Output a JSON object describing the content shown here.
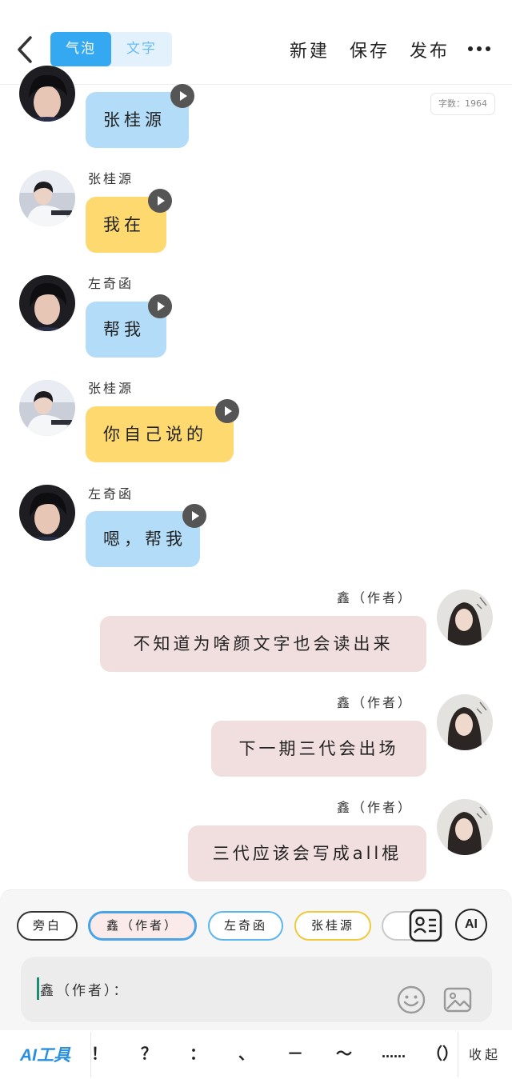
{
  "header": {
    "tabs": [
      {
        "label": "气泡",
        "active": true
      },
      {
        "label": "文字",
        "active": false
      }
    ],
    "actions": [
      "新建",
      "保存",
      "发布"
    ]
  },
  "word_count": "字数：1964",
  "messages": [
    {
      "speaker": "",
      "text": "张桂源",
      "color": "#b3dcf8"
    },
    {
      "speaker": "张桂源",
      "text": "我在",
      "color": "#fdd970"
    },
    {
      "speaker": "左奇函",
      "text": "帮我",
      "color": "#b3dcf8"
    },
    {
      "speaker": "张桂源",
      "text": "你自己说的",
      "color": "#fdd970"
    },
    {
      "speaker": "左奇函",
      "text": "嗯，帮我",
      "color": "#b3dcf8"
    },
    {
      "speaker": "鑫（作者）",
      "text": "不知道为啥颜文字也会读出来",
      "color": "#f1dede"
    },
    {
      "speaker": "鑫（作者）",
      "text": "下一期三代会出场",
      "color": "#f1dede"
    },
    {
      "speaker": "鑫（作者）",
      "text": "三代应该会写成all棍",
      "color": "#f1dede"
    }
  ],
  "roles": [
    "旁白",
    "鑫（作者）",
    "左奇函",
    "张桂源"
  ],
  "ai_label": "AI",
  "input": {
    "value": "鑫（作者）："
  },
  "toolbar": {
    "ai_tools": "AI工具",
    "punctuation": [
      "！",
      "？",
      "：",
      "、",
      "－",
      "～",
      "……",
      "（）"
    ],
    "collapse": "收起"
  }
}
